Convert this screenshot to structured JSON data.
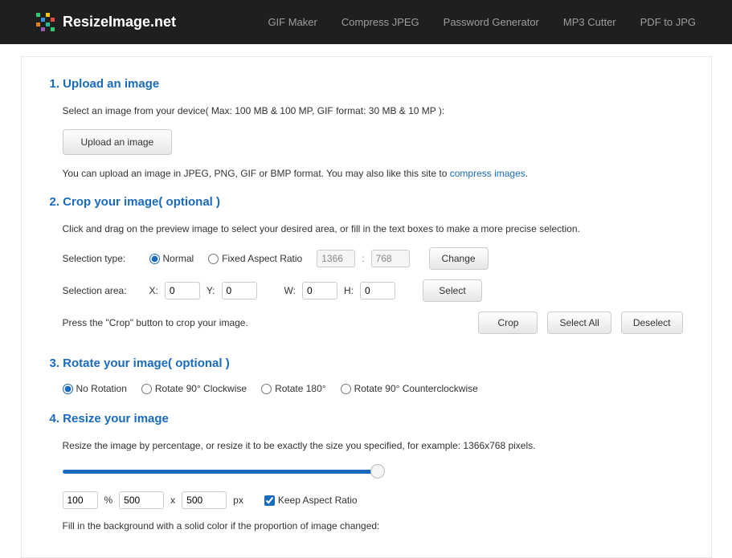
{
  "brand": "ResizeImage.net",
  "nav": {
    "gif_maker": "GIF Maker",
    "compress_jpeg": "Compress JPEG",
    "password_generator": "Password Generator",
    "mp3_cutter": "MP3 Cutter",
    "pdf_to_jpg": "PDF to JPG"
  },
  "s1": {
    "title": "1. Upload an image",
    "desc": "Select an image from your device( Max: 100 MB & 100 MP, GIF format: 30 MB & 10 MP ):",
    "btn": "Upload an image",
    "desc2_a": "You can upload an image in JPEG, PNG, GIF or BMP format. You may also like this site to ",
    "desc2_link": "compress images",
    "desc2_b": "."
  },
  "s2": {
    "title": "2. Crop your image( optional )",
    "desc": "Click and drag on the preview image to select your desired area, or fill in the text boxes to make a more precise selection.",
    "sel_type": "Selection type:",
    "normal": "Normal",
    "fixed": "Fixed Aspect Ratio",
    "ratio_w": "1366",
    "ratio_h": "768",
    "change": "Change",
    "sel_area": "Selection area:",
    "x": "X:",
    "y": "Y:",
    "w": "W:",
    "h": "H:",
    "xv": "0",
    "yv": "0",
    "wv": "0",
    "hv": "0",
    "select": "Select",
    "press": "Press the \"Crop\" button to crop your image.",
    "crop": "Crop",
    "select_all": "Select All",
    "deselect": "Deselect"
  },
  "s3": {
    "title": "3. Rotate your image( optional )",
    "none": "No Rotation",
    "cw": "Rotate 90° Clockwise",
    "r180": "Rotate 180°",
    "ccw": "Rotate 90° Counterclockwise"
  },
  "s4": {
    "title": "4. Resize your image",
    "desc": "Resize the image by percentage, or resize it to be exactly the size you specified, for example: 1366x768 pixels.",
    "percent": "100",
    "percent_unit": "%",
    "w": "500",
    "times": "x",
    "h": "500",
    "px": "px",
    "keep": "Keep Aspect Ratio",
    "fill": "Fill in the background with a solid color if the proportion of image changed:"
  }
}
